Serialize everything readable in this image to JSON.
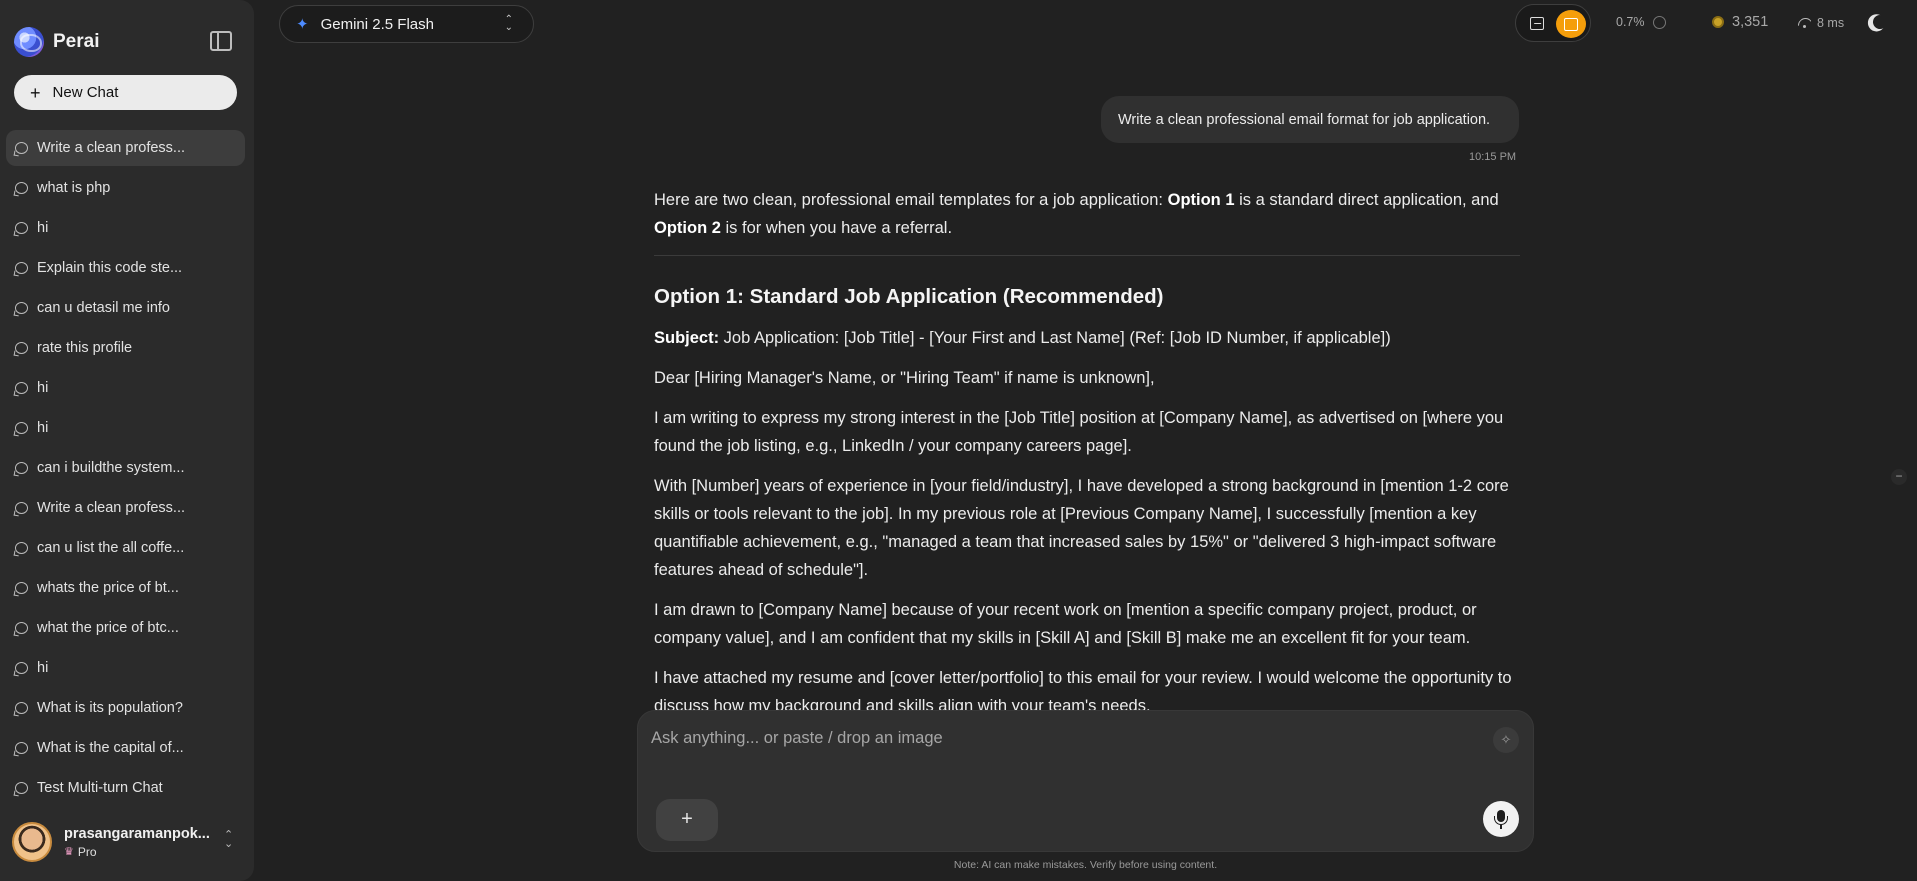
{
  "sidebar": {
    "brand": "Perai",
    "new_chat_label": "New Chat",
    "history": [
      "Write a clean profess...",
      "what is php",
      "hi",
      "Explain this code ste...",
      "can u detasil me info",
      "rate this profile",
      "hi",
      "hi",
      "can i buildthe system...",
      "Write a clean profess...",
      "can u list the all coffe...",
      "whats the price of bt...",
      "what the price of btc...",
      "hi",
      "What is its population?",
      "What is the capital of...",
      "Test Multi-turn Chat"
    ],
    "user": {
      "name": "prasangaramanpok...",
      "plan": "Pro"
    }
  },
  "topbar": {
    "model": "Gemini 2.5 Flash",
    "usage_percent": "0.7%",
    "credits": "3,351",
    "latency": "8 ms"
  },
  "chat": {
    "user_message": "Write a clean professional email format for job application.",
    "time": "10:15 PM",
    "answer": {
      "intro_pre": "Here are two clean, professional email templates for a job application: ",
      "intro_opt1": "Option 1",
      "intro_mid": " is a standard direct application, and ",
      "intro_opt2": "Option 2",
      "intro_post": " is for when you have a referral.",
      "heading": "Option 1: Standard Job Application (Recommended)",
      "subject_label": "Subject:",
      "subject_text": " Job Application: [Job Title] - [Your First and Last Name] (Ref: [Job ID Number, if applicable])",
      "greeting": "Dear [Hiring Manager's Name, or \"Hiring Team\" if name is unknown],",
      "p1": "I am writing to express my strong interest in the [Job Title] position at [Company Name], as advertised on [where you found the job listing, e.g., LinkedIn / your company careers page].",
      "p2": "With [Number] years of experience in [your field/industry], I have developed a strong background in [mention 1-2 core skills or tools relevant to the job]. In my previous role at [Previous Company Name], I successfully [mention a key quantifiable achievement, e.g., \"managed a team that increased sales by 15%\" or \"delivered 3 high-impact software features ahead of schedule\"].",
      "p3": "I am drawn to [Company Name] because of your recent work on [mention a specific company project, product, or company value], and I am confident that my skills in [Skill A] and [Skill B] make me an excellent fit for your team.",
      "p4": "I have attached my resume and [cover letter/portfolio] to this email for your review. I would welcome the opportunity to discuss how my background and skills align with your team's needs."
    }
  },
  "composer": {
    "placeholder": "Ask anything... or paste / drop an image",
    "note": "Note: AI can make mistakes. Verify before using content."
  }
}
